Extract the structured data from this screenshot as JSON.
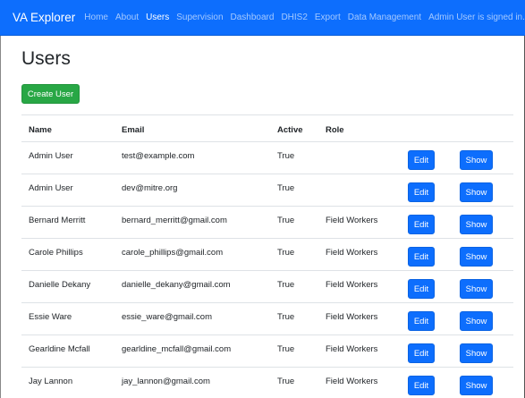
{
  "navbar": {
    "brand": "VA Explorer",
    "links": [
      {
        "label": "Home",
        "active": false
      },
      {
        "label": "About",
        "active": false
      },
      {
        "label": "Users",
        "active": true
      },
      {
        "label": "Supervision",
        "active": false
      },
      {
        "label": "Dashboard",
        "active": false
      },
      {
        "label": "DHIS2",
        "active": false
      },
      {
        "label": "Export",
        "active": false
      },
      {
        "label": "Data Management",
        "active": false
      }
    ],
    "user_menu": "Admin User is signed in."
  },
  "page": {
    "title": "Users",
    "create_button": "Create User"
  },
  "table": {
    "headers": {
      "name": "Name",
      "email": "Email",
      "active": "Active",
      "role": "Role"
    },
    "edit_label": "Edit",
    "show_label": "Show",
    "rows": [
      {
        "name": "Admin User",
        "email": "test@example.com",
        "active": "True",
        "role": ""
      },
      {
        "name": "Admin User",
        "email": "dev@mitre.org",
        "active": "True",
        "role": ""
      },
      {
        "name": "Bernard Merritt",
        "email": "bernard_merritt@gmail.com",
        "active": "True",
        "role": "Field Workers"
      },
      {
        "name": "Carole Phillips",
        "email": "carole_phillips@gmail.com",
        "active": "True",
        "role": "Field Workers"
      },
      {
        "name": "Danielle Dekany",
        "email": "danielle_dekany@gmail.com",
        "active": "True",
        "role": "Field Workers"
      },
      {
        "name": "Essie Ware",
        "email": "essie_ware@gmail.com",
        "active": "True",
        "role": "Field Workers"
      },
      {
        "name": "Gearldine Mcfall",
        "email": "gearldine_mcfall@gmail.com",
        "active": "True",
        "role": "Field Workers"
      },
      {
        "name": "Jay Lannon",
        "email": "jay_lannon@gmail.com",
        "active": "True",
        "role": "Field Workers"
      }
    ]
  },
  "colors": {
    "navbar": "#0d6efd",
    "primary_button": "#0d6efd",
    "success_button": "#28a745"
  },
  "icons": {
    "user_menu": "caret-down-icon"
  }
}
